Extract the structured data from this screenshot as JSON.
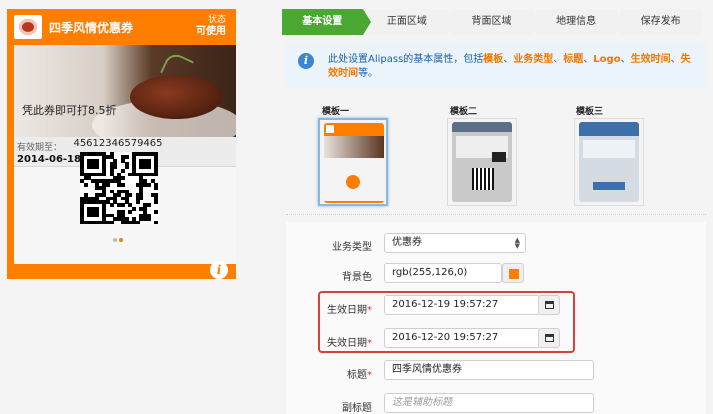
{
  "card": {
    "title": "四季风情优惠券",
    "status_label": "状态",
    "status_value": "可使用",
    "strip_text": "凭此券即可打8.5折",
    "valid_label": "有效期至：",
    "valid_value": "2014-06-18 23:59:59",
    "code_number": "45612346579465",
    "info_icon": "i",
    "pager": {
      "count": 2,
      "active": 1
    },
    "colors": {
      "background": "#ff7e00"
    }
  },
  "steps": [
    {
      "label": "基本设置",
      "active": true
    },
    {
      "label": "正面区域",
      "active": false
    },
    {
      "label": "背面区域",
      "active": false
    },
    {
      "label": "地理信息",
      "active": false
    },
    {
      "label": "保存发布",
      "active": false
    }
  ],
  "info": {
    "icon": "info-icon",
    "prefix": "此处设置Alipass的基本属性，包括",
    "items": [
      "模板",
      "业务类型",
      "标题",
      "Logo",
      "生效时间",
      "失效时间"
    ],
    "separator": "、",
    "suffix": "等。"
  },
  "templates": [
    {
      "label": "模板一",
      "selected": true
    },
    {
      "label": "模板二",
      "selected": false
    },
    {
      "label": "模板三",
      "selected": false
    }
  ],
  "form": {
    "business_type": {
      "label": "业务类型",
      "value": "优惠券"
    },
    "background_color": {
      "label": "背景色",
      "value": "rgb(255,126,0)",
      "swatch": "#ff7e00"
    },
    "start_date": {
      "label": "生效日期",
      "value": "2016-12-19 19:57:27",
      "required": true
    },
    "end_date": {
      "label": "失效日期",
      "value": "2016-12-20 19:57:27",
      "required": true
    },
    "title": {
      "label": "标题",
      "value": "四季风情优惠券",
      "required": true
    },
    "subtitle": {
      "label": "副标题",
      "placeholder": "这是辅助标题"
    }
  },
  "colors": {
    "accent_green": "#4aa832",
    "highlight_red": "#d9403a",
    "info_blue": "#1c60a8",
    "info_orange": "#f07800"
  }
}
